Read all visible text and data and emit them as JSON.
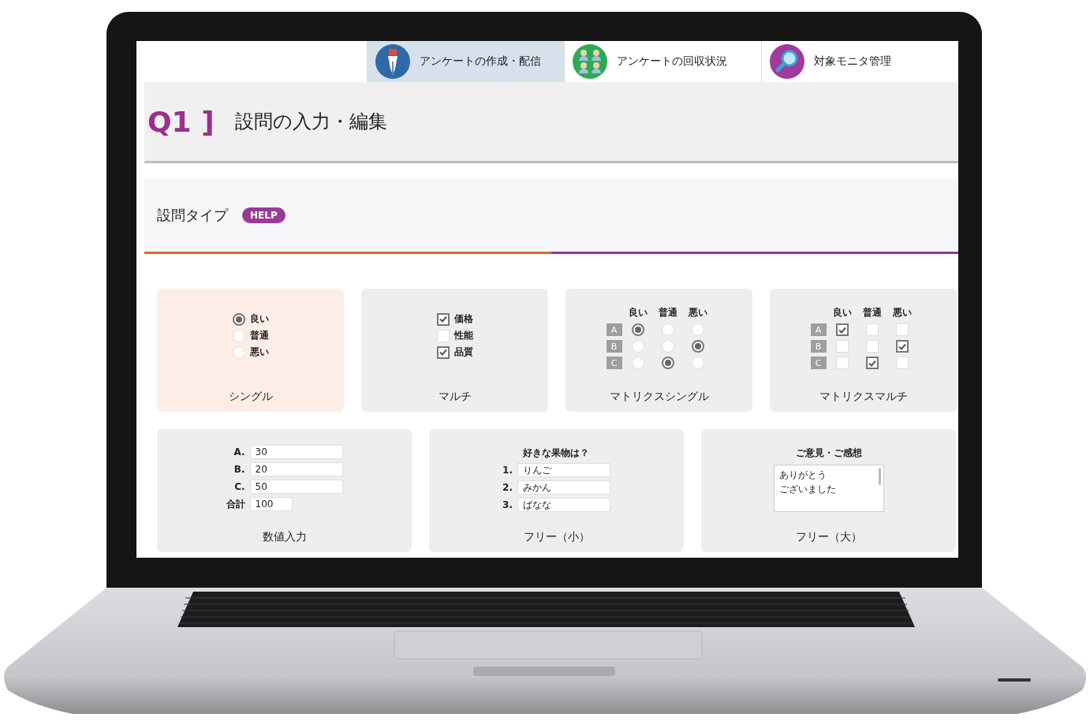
{
  "tabs": [
    {
      "label": "アンケートの作成・配信",
      "kind": "pen",
      "selected": true
    },
    {
      "label": "アンケートの回収状況",
      "kind": "people",
      "selected": false
    },
    {
      "label": "対象モニタ管理",
      "kind": "search",
      "selected": false
    }
  ],
  "heading": {
    "number": "Q1 ]",
    "title": "設問の入力・編集"
  },
  "section": {
    "title": "設問タイプ",
    "help": "HELP"
  },
  "cards": [
    {
      "kind": "radio",
      "label": "シングル",
      "selected": true,
      "options": [
        {
          "label": "良い",
          "checked": true
        },
        {
          "label": "普通",
          "checked": false
        },
        {
          "label": "悪い",
          "checked": false
        }
      ]
    },
    {
      "kind": "checkbox",
      "label": "マルチ",
      "selected": false,
      "options": [
        {
          "label": "価格",
          "checked": true
        },
        {
          "label": "性能",
          "checked": false
        },
        {
          "label": "品質",
          "checked": true
        }
      ]
    },
    {
      "kind": "matrix_radio",
      "label": "マトリクスシングル",
      "selected": false,
      "columns": [
        "良い",
        "普通",
        "悪い"
      ],
      "rows": [
        {
          "label": "A",
          "cells": [
            {
              "checked": true
            },
            {
              "checked": false
            },
            {
              "checked": false
            }
          ]
        },
        {
          "label": "B",
          "cells": [
            {
              "checked": false
            },
            {
              "checked": false
            },
            {
              "checked": true
            }
          ]
        },
        {
          "label": "C",
          "cells": [
            {
              "checked": false
            },
            {
              "checked": true
            },
            {
              "checked": false
            }
          ]
        }
      ]
    },
    {
      "kind": "matrix_checkbox",
      "label": "マトリクスマルチ",
      "selected": false,
      "columns": [
        "良い",
        "普通",
        "悪い"
      ],
      "rows": [
        {
          "label": "A",
          "cells": [
            {
              "checked": true
            },
            {
              "checked": false
            },
            {
              "checked": false
            }
          ]
        },
        {
          "label": "B",
          "cells": [
            {
              "checked": false
            },
            {
              "checked": false
            },
            {
              "checked": true
            }
          ]
        },
        {
          "label": "C",
          "cells": [
            {
              "checked": false
            },
            {
              "checked": true
            },
            {
              "checked": false
            }
          ]
        }
      ]
    },
    {
      "kind": "numeric",
      "label": "数値入力",
      "selected": false,
      "fields": [
        {
          "label": "A.",
          "value": "30"
        },
        {
          "label": "B.",
          "value": "20"
        },
        {
          "label": "C.",
          "value": "50"
        }
      ],
      "total": {
        "label": "合計",
        "value": "100"
      }
    },
    {
      "kind": "free_small",
      "label": "フリー（小）",
      "selected": false,
      "prompt": "好きな果物は？",
      "fields": [
        {
          "label": "1.",
          "value": "りんご"
        },
        {
          "label": "2.",
          "value": "みかん"
        },
        {
          "label": "3.",
          "value": "ばなな"
        }
      ]
    },
    {
      "kind": "free_large",
      "label": "フリー（大）",
      "selected": false,
      "prompt": "ご意見・ご感想",
      "lines": [
        "ありがとう",
        "ございました"
      ]
    }
  ]
}
